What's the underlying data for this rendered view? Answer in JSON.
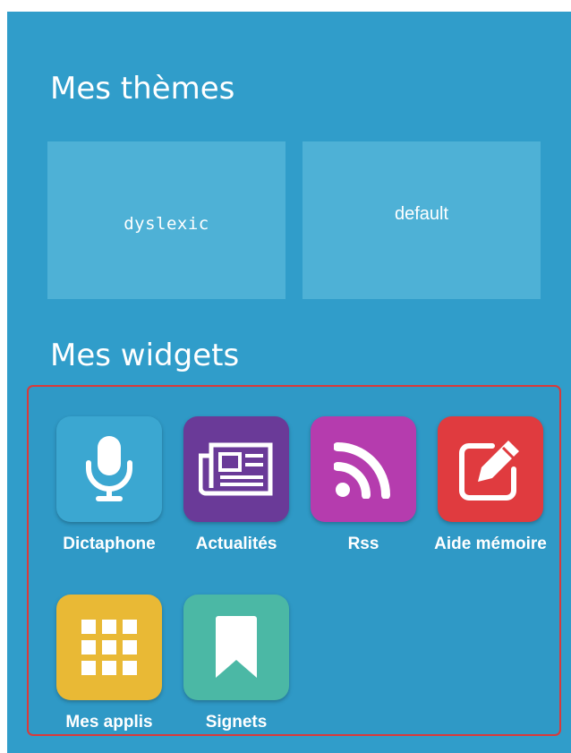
{
  "sections": {
    "themes_title": "Mes thèmes",
    "widgets_title": "Mes widgets"
  },
  "themes": [
    {
      "label": "dyslexic"
    },
    {
      "label": "default"
    }
  ],
  "widgets": [
    {
      "label": "Dictaphone",
      "icon": "microphone-icon",
      "color": "#3ba7d1"
    },
    {
      "label": "Actualités",
      "icon": "newspaper-icon",
      "color": "#6a3a98"
    },
    {
      "label": "Rss",
      "icon": "rss-icon",
      "color": "#b53cae"
    },
    {
      "label": "Aide mémoire",
      "icon": "edit-note-icon",
      "color": "#e03b3f"
    },
    {
      "label": "Mes applis",
      "icon": "apps-grid-icon",
      "color": "#e9b935"
    },
    {
      "label": "Signets",
      "icon": "bookmark-icon",
      "color": "#4bb8a5"
    }
  ],
  "colors": {
    "panel_background": "#309dca",
    "theme_card": "#4eb1d6",
    "highlight_border": "#d93a3a"
  }
}
